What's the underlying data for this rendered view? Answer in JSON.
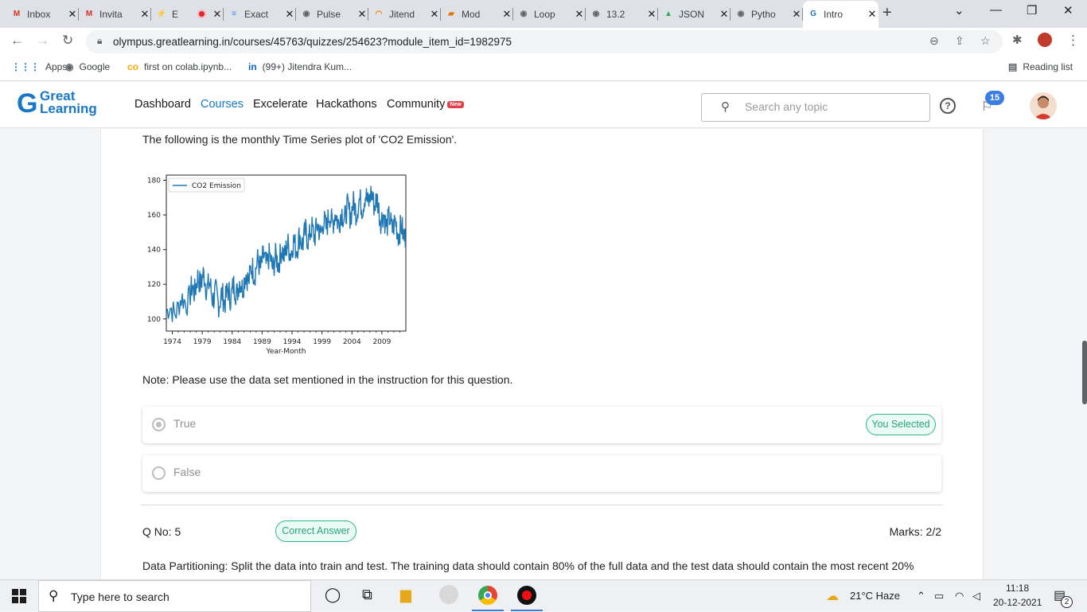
{
  "browser": {
    "tabs": [
      {
        "title": "Inbox",
        "icon": "gmail-icon",
        "fav": "M",
        "color": "#d93025"
      },
      {
        "title": "Invita",
        "icon": "gmail-icon",
        "fav": "M",
        "color": "#d93025"
      },
      {
        "title": "E",
        "icon": "jira-icon",
        "fav": "⚡",
        "color": "#3867d6",
        "recording": true
      },
      {
        "title": "Exact",
        "icon": "docs-icon",
        "fav": "≡",
        "color": "#4285f4"
      },
      {
        "title": "Pulse",
        "icon": "globe-icon",
        "fav": "◉",
        "color": "#5f6368"
      },
      {
        "title": "Jitend",
        "icon": "loading-icon",
        "fav": "◠",
        "color": "#f57c00"
      },
      {
        "title": "Mod",
        "icon": "notebook-icon",
        "fav": "▰",
        "color": "#e37400"
      },
      {
        "title": "Loop",
        "icon": "globe-icon",
        "fav": "◉",
        "color": "#5f6368"
      },
      {
        "title": "13.2",
        "icon": "globe-icon",
        "fav": "◉",
        "color": "#5f6368"
      },
      {
        "title": "JSON",
        "icon": "drive-icon",
        "fav": "▲",
        "color": "#34a853"
      },
      {
        "title": "Pytho",
        "icon": "globe-icon",
        "fav": "◉",
        "color": "#5f6368"
      },
      {
        "title": "Intro",
        "icon": "greatlearning-icon",
        "fav": "G",
        "color": "#1877c6",
        "active": true
      }
    ],
    "url": "olympus.greatlearning.in/courses/45763/quizzes/254623?module_item_id=1982975",
    "bookmarks": [
      {
        "label": "Apps",
        "icon": "apps-grid-icon",
        "glyph": "⋮⋮⋮",
        "color": "#1a73e8"
      },
      {
        "label": "Google",
        "icon": "globe-icon",
        "glyph": "◉",
        "color": "#5f6368"
      },
      {
        "label": "first on colab.ipynb...",
        "icon": "colab-icon",
        "glyph": "co",
        "color": "#f9ab00"
      },
      {
        "label": "(99+) Jitendra Kum...",
        "icon": "linkedin-icon",
        "glyph": "in",
        "color": "#0a66c2"
      }
    ],
    "reading_list": "Reading list"
  },
  "header": {
    "logo_top": "Great",
    "logo_bottom": "Learning",
    "nav": [
      "Dashboard",
      "Courses",
      "Excelerate",
      "Hackathons",
      "Community"
    ],
    "new_badge": "New",
    "search_placeholder": "Search any topic",
    "notifications": "15"
  },
  "question4": {
    "intro": "The following is the monthly Time Series plot of 'CO2 Emission'.",
    "note": "Note: Please use the data set mentioned in the instruction for this question.",
    "options": [
      {
        "label": "True",
        "selected": true,
        "badge": "You Selected"
      },
      {
        "label": "False",
        "selected": false
      }
    ]
  },
  "question5": {
    "number": "Q No: 5",
    "status": "Correct Answer",
    "marks": "Marks: 2/2",
    "text": "Data Partitioning: Split the data into train and test. The training data should contain 80% of the full data and the test data should contain the most recent 20%"
  },
  "chart_data": {
    "type": "line",
    "title": "",
    "xlabel": "Year-Month",
    "ylabel": "",
    "x_ticks": [
      "1974",
      "1979",
      "1984",
      "1989",
      "1994",
      "1999",
      "2004",
      "2009"
    ],
    "y_ticks": [
      100,
      120,
      140,
      160,
      180
    ],
    "xlim": [
      1973,
      2013
    ],
    "ylim": [
      93,
      183
    ],
    "legend": "top-left",
    "series": [
      {
        "name": "CO2 Emission",
        "color": "#1f77b4",
        "x": [
          1973.0,
          1975.0,
          1977.0,
          1978.0,
          1979.0,
          1980.0,
          1981.0,
          1982.0,
          1983.0,
          1984.0,
          1985.0,
          1986.0,
          1987.0,
          1988.0,
          1989.0,
          1990.0,
          1991.0,
          1992.0,
          1993.0,
          1994.0,
          1995.0,
          1996.0,
          1997.0,
          1998.0,
          1999.0,
          2000.0,
          2001.0,
          2002.0,
          2003.0,
          2004.0,
          2005.0,
          2006.0,
          2007.0,
          2008.0,
          2009.0,
          2010.0,
          2011.0,
          2012.0,
          2013.0
        ],
        "y": [
          103,
          107,
          114,
          120,
          124,
          119,
          113,
          111,
          113,
          116,
          118,
          122,
          126,
          130,
          133,
          134,
          132,
          136,
          140,
          141,
          144,
          147,
          149,
          151,
          152,
          157,
          158,
          158,
          161,
          163,
          165,
          168,
          170,
          168,
          158,
          156,
          154,
          151,
          149
        ]
      }
    ],
    "noise_amplitude": 8
  },
  "taskbar": {
    "search": "Type here to search",
    "weather": "21°C  Haze",
    "time": "11:18",
    "date": "20-12-2021",
    "notifications": "2"
  }
}
